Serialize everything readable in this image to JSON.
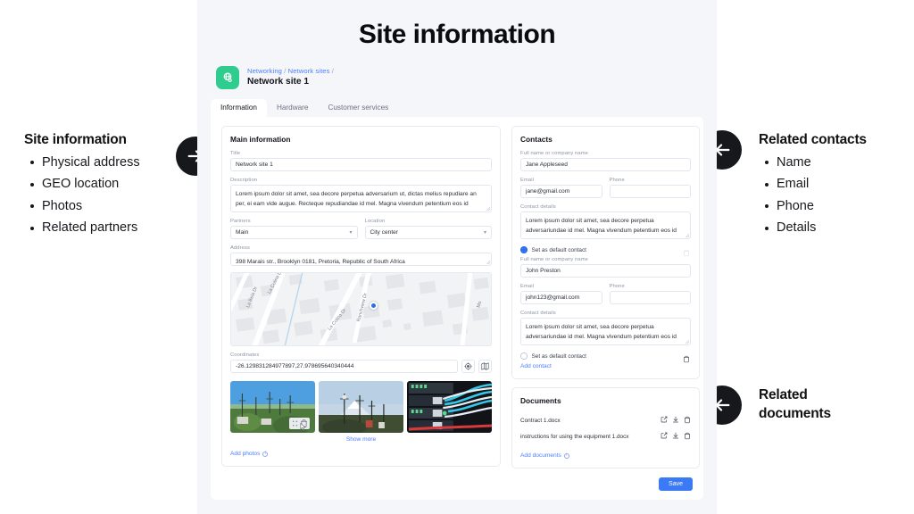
{
  "page": {
    "title": "Site information"
  },
  "annotations": {
    "left": {
      "heading": "Site information",
      "items": [
        "Physical address",
        "GEO location",
        "Photos",
        "Related partners"
      ],
      "arrow": "arrow-right-icon"
    },
    "right_contacts": {
      "heading": "Related contacts",
      "items": [
        "Name",
        "Email",
        "Phone",
        "Details"
      ],
      "arrow": "arrow-left-icon"
    },
    "right_documents": {
      "heading": "Related documents",
      "arrow": "arrow-left-icon"
    }
  },
  "app": {
    "breadcrumb": {
      "parent": "Networking",
      "child": "Network sites",
      "separator": "/"
    },
    "record_title": "Network site 1",
    "tabs": [
      {
        "label": "Information",
        "active": true
      },
      {
        "label": "Hardware",
        "active": false
      },
      {
        "label": "Customer services",
        "active": false
      }
    ],
    "main_information": {
      "title": "Main information",
      "fields": {
        "title_label": "Title",
        "title_value": "Network site 1",
        "description_label": "Description",
        "description_value": "Lorem ipsum dolor sit amet, sea decore perpetua adversarium ut, dictas melius repudiare an per, ei eam vide augue. Recteque repudiandae id mel. Magna vivendum petentium eos id",
        "partners_label": "Partners",
        "partners_value": "Main",
        "location_label": "Location",
        "location_value": "City center",
        "address_label": "Address",
        "address_value": "398 Marais str., Brooklyn 0181, Pretoria, Republic of South Africa",
        "coordinates_label": "Coordinates",
        "coordinates_value": "-26.129831284977897,27.978695640340444"
      },
      "map": {
        "streets": [
          "La Bela Dr",
          "La Colina Dr",
          "La Colina Dr",
          "Ranchview Dr",
          "Mo"
        ],
        "pin": "map-pin-icon"
      },
      "coordinate_buttons": [
        {
          "icon": "locate-crosshair-icon"
        },
        {
          "icon": "map-view-icon"
        }
      ],
      "photos": [
        {
          "alt": "telecom towers on green hillside"
        },
        {
          "alt": "telecom tower with snow-capped mountain"
        },
        {
          "alt": "network switch with blue and red cables"
        }
      ],
      "photo_tools": [
        "move-icon",
        "delete-icon"
      ],
      "show_more": "Show more",
      "add_photos": "Add photos"
    },
    "contacts": {
      "title": "Contacts",
      "labels": {
        "name": "Full name or company name",
        "email": "Email",
        "phone": "Phone",
        "details": "Contact details",
        "default": "Set as default contact"
      },
      "entries": [
        {
          "name": "Jane Appleseed",
          "email": "jane@gmail.com",
          "phone": "",
          "details": "Lorem ipsum dolor sit amet, sea decore perpetua adversariundae id mel. Magna vivendum petentium eos id",
          "is_default": true
        },
        {
          "name": "John Preston",
          "email": "john123@gmail.com",
          "phone": "",
          "details": "Lorem ipsum dolor sit amet, sea decore perpetua adversariundae id mel. Magna vivendum petentium eos id",
          "is_default": false
        }
      ],
      "add_contact": "Add contact"
    },
    "documents": {
      "title": "Documents",
      "files": [
        {
          "name": "Contract 1.docx"
        },
        {
          "name": "instructions for using the equipment 1.docx"
        }
      ],
      "actions": [
        "open-external-icon",
        "download-icon",
        "delete-icon"
      ],
      "add_documents": "Add documents"
    },
    "save_label": "Save"
  },
  "colors": {
    "accent_blue": "#3b7af5",
    "link_blue": "#4a7dfd",
    "brand_green": "#2ecc8f",
    "app_bg": "#f5f6fa",
    "badge_dark": "#16181c"
  }
}
